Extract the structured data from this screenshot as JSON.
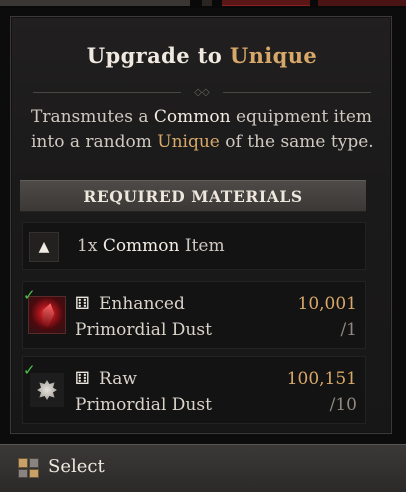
{
  "panel": {
    "title_prefix": "Upgrade to ",
    "title_accent": "Unique",
    "description": {
      "p1": "Transmutes a ",
      "w1": "Common",
      "p2": " equipment item into a random ",
      "u1": "Unique",
      "p3": " of the same type."
    },
    "required_header": "REQUIRED MATERIALS"
  },
  "requirements": {
    "item": {
      "prefix": "1x ",
      "bold": "Common",
      "suffix": " Item",
      "icon": "up-triangle-icon"
    },
    "materials": [
      {
        "name_line1": "Enhanced",
        "name_line2": "Primordial Dust",
        "have": "10,001",
        "need": "/1",
        "icon": "red-primordial-dust-icon",
        "satisfied": true
      },
      {
        "name_line1": "Raw",
        "name_line2": "Primordial Dust",
        "have": "100,151",
        "need": "/10",
        "icon": "white-primordial-dust-icon",
        "satisfied": true
      }
    ]
  },
  "footer": {
    "select_label": "Select",
    "icon": "controller-button-icon"
  },
  "colors": {
    "accent": "#d8a86a",
    "check": "#4cc04a",
    "panel_bg": "#1b1a1a"
  }
}
